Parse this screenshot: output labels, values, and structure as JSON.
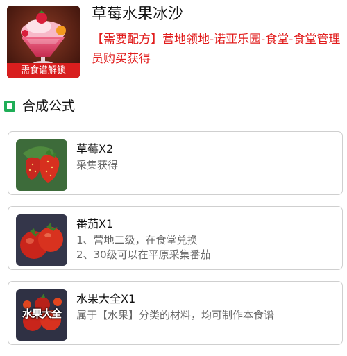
{
  "product": {
    "title": "草莓水果冰沙",
    "lock_badge": "需食谱解锁",
    "icon": "strawberry-smoothie-icon",
    "source_line": "【需要配方】营地领地-诺亚乐园-食堂-食堂管理员购买获得"
  },
  "section": {
    "label": "合成公式",
    "icon": "square-bullet-icon",
    "accent_color": "#1fae57"
  },
  "ingredients": [
    {
      "name": "草莓X2",
      "icon": "strawberry-icon",
      "desc": [
        "采集获得"
      ]
    },
    {
      "name": "番茄X1",
      "icon": "tomato-icon",
      "desc": [
        "1、营地二级，在食堂兑换",
        "2、30级可以在平原采集番茄"
      ]
    },
    {
      "name": "水果大全X1",
      "icon": "fruit-collection-icon",
      "thumb_text": "水果大全",
      "desc": [
        "属于【水果】分类的材料，均可制作本食谱"
      ]
    }
  ],
  "colors": {
    "source_text": "#e11d1d",
    "lock_badge": "#d81e1e",
    "card_border": "#cfcfcf"
  }
}
